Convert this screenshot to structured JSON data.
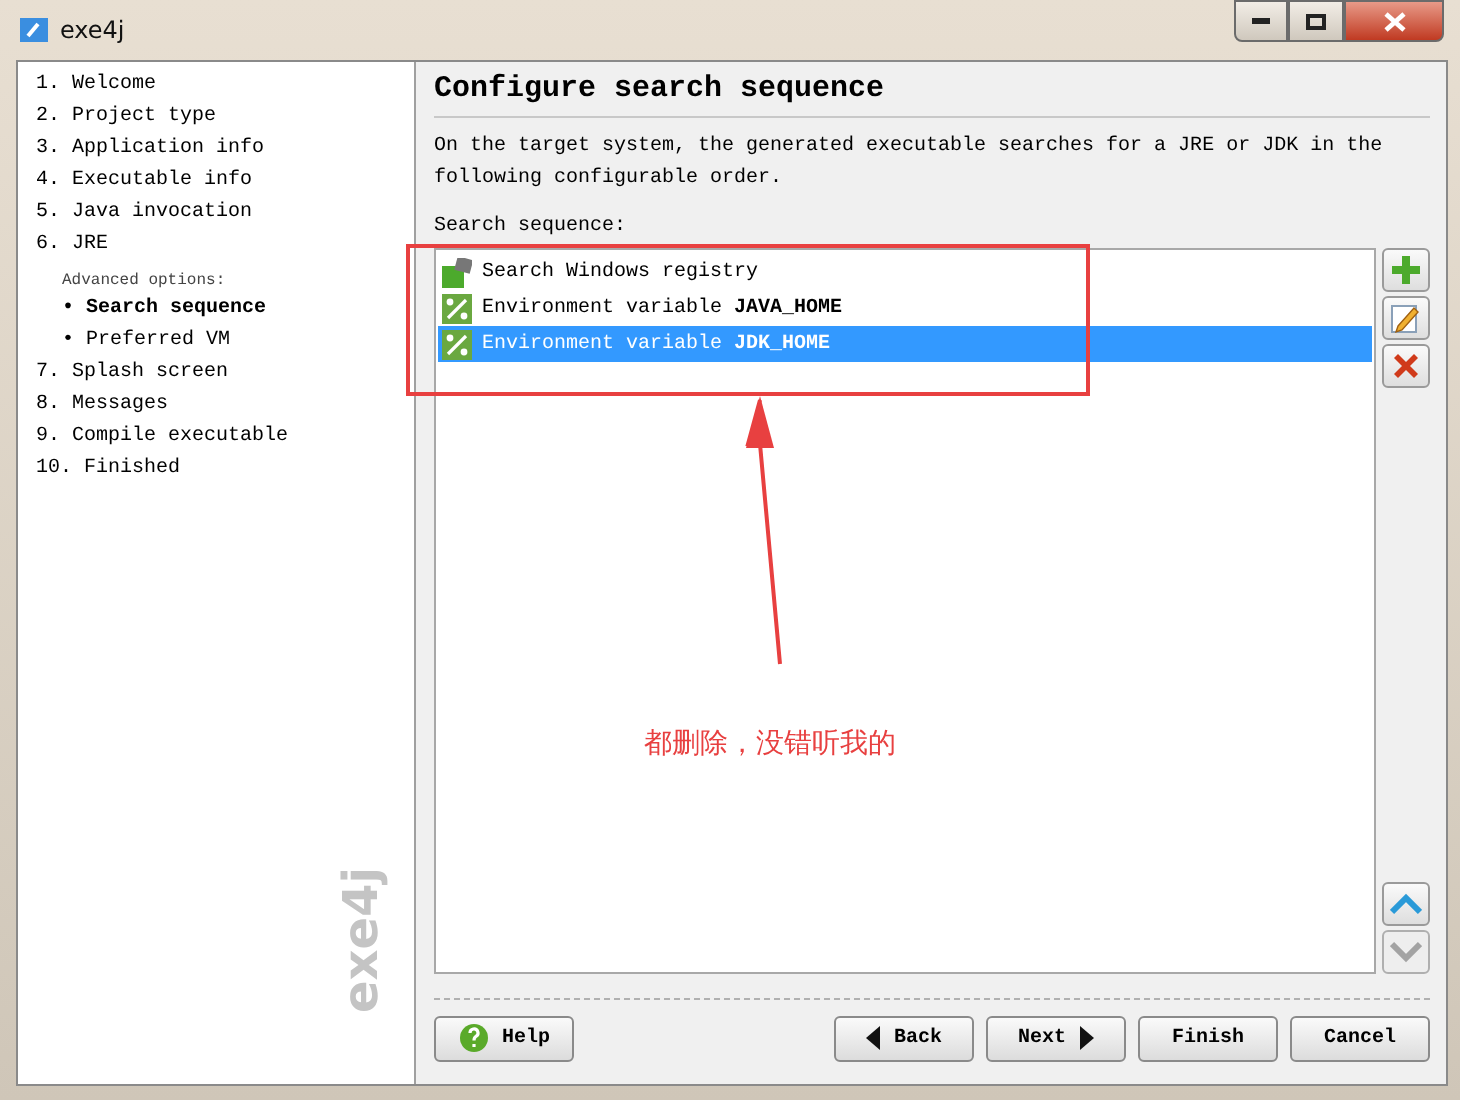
{
  "window": {
    "title": "exe4j"
  },
  "steps": [
    {
      "number": "1.",
      "label": "Welcome",
      "selected": false
    },
    {
      "number": "2.",
      "label": "Project type",
      "selected": false
    },
    {
      "number": "3.",
      "label": "Application info",
      "selected": false
    },
    {
      "number": "4.",
      "label": "Executable info",
      "selected": false
    },
    {
      "number": "5.",
      "label": "Java invocation",
      "selected": false
    },
    {
      "number": "6.",
      "label": "JRE",
      "selected": false,
      "subheading": "Advanced options:",
      "children": [
        {
          "bullet": "•",
          "label": "Search sequence",
          "selected": true
        },
        {
          "bullet": "•",
          "label": "Preferred VM",
          "selected": false
        }
      ]
    },
    {
      "number": "7.",
      "label": "Splash screen",
      "selected": false
    },
    {
      "number": "8.",
      "label": "Messages",
      "selected": false
    },
    {
      "number": "9.",
      "label": "Compile executable",
      "selected": false
    },
    {
      "number": "10.",
      "label": "Finished",
      "selected": false
    }
  ],
  "sidebar_logo": "exe4j",
  "page": {
    "title": "Configure search sequence",
    "description": "On the target system, the generated executable searches for a JRE or JDK in the following configurable order.",
    "list_label": "Search sequence:"
  },
  "search_list": [
    {
      "kind": "registry",
      "text": "Search Windows registry",
      "selected": false
    },
    {
      "kind": "env",
      "text": "Environment variable **JAVA_HOME**",
      "selected": false
    },
    {
      "kind": "env",
      "text": "Environment variable **JDK_HOME**",
      "selected": true
    }
  ],
  "list_buttons": [
    {
      "kind": "add",
      "disabled": false
    },
    {
      "kind": "edit",
      "disabled": false
    },
    {
      "kind": "delete",
      "disabled": false
    },
    {
      "kind": "up",
      "disabled": false
    },
    {
      "kind": "down",
      "disabled": true
    }
  ],
  "buttons": [
    {
      "kind": "help",
      "label": "Help"
    },
    {
      "kind": "back",
      "label": "Back"
    },
    {
      "kind": "next",
      "label": "Next"
    },
    {
      "kind": "plain",
      "label": "Finish"
    },
    {
      "kind": "plain",
      "label": "Cancel"
    }
  ],
  "annotation": {
    "text": "都删除，没错听我的"
  }
}
